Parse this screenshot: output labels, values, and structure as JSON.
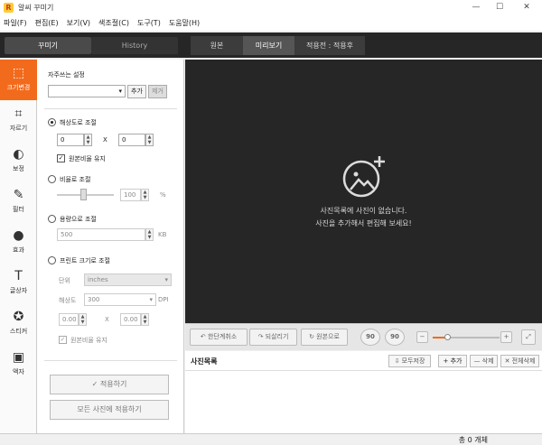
{
  "window": {
    "title": "알씨 꾸미기",
    "logo": "R",
    "minimize": "—",
    "maximize": "☐",
    "close": "✕"
  },
  "menu": [
    "파일(F)",
    "편집(E)",
    "보기(V)",
    "색조절(C)",
    "도구(T)",
    "도움말(H)"
  ],
  "left_tabs": {
    "edit": "꾸미기",
    "history": "History"
  },
  "view_tabs": {
    "original": "원본",
    "preview": "미리보기",
    "compare": "적용전 : 적용후"
  },
  "tools": [
    {
      "label": "크기변경",
      "icon": "resize-icon",
      "glyph": "⬚",
      "active": true
    },
    {
      "label": "자르기",
      "icon": "crop-icon",
      "glyph": "⌗",
      "active": false
    },
    {
      "label": "보정",
      "icon": "adjust-icon",
      "glyph": "◐",
      "active": false
    },
    {
      "label": "필터",
      "icon": "filter-wand-icon",
      "glyph": "✎",
      "active": false
    },
    {
      "label": "효과",
      "icon": "effect-drop-icon",
      "glyph": "●",
      "active": false
    },
    {
      "label": "글상자",
      "icon": "text-icon",
      "glyph": "T",
      "active": false
    },
    {
      "label": "스티커",
      "icon": "sticker-icon",
      "glyph": "✪",
      "active": false
    },
    {
      "label": "액자",
      "icon": "frame-icon",
      "glyph": "▣",
      "active": false
    }
  ],
  "panel": {
    "presets_label": "자주쓰는 설정",
    "preset_value": "",
    "add": "추가",
    "remove": "제거",
    "by_resolution": "해상도로 조절",
    "width": "0",
    "times": "X",
    "height": "0",
    "keep_ratio": "원본비율 유지",
    "by_ratio": "비율로 조절",
    "ratio_value": "100",
    "percent": "%",
    "by_size": "용량으로 조절",
    "size_value": "500",
    "kb": "KB",
    "by_print": "프린트 크기로 조절",
    "unit_label": "단위",
    "unit_value": "inches",
    "dpi_label": "해상도",
    "dpi_value": "300",
    "dpi": "DPI",
    "print_w": "0.00",
    "print_times": "X",
    "print_h": "0.00",
    "print_keep_ratio": "원본비율 유지",
    "apply": "적용하기",
    "apply_all": "모든 사진에 적용하기"
  },
  "canvas": {
    "empty_line1": "사진목록에 사진이 없습니다.",
    "empty_line2": "사진을 추가해서 편집해 보세요!"
  },
  "controls": {
    "undo": "한단계취소",
    "redo": "되살리기",
    "revert": "원본으로",
    "rot_left": "90",
    "rot_right": "90",
    "zoom_level": 0.22
  },
  "list": {
    "title": "사진목록",
    "save_all": "모두저장",
    "add": "+ 추가",
    "delete": "— 삭제",
    "delete_all": "✕ 전체삭제"
  },
  "status": {
    "count": "총 0 개체"
  },
  "colors": {
    "accent": "#f26b1d",
    "dark": "#262626"
  }
}
